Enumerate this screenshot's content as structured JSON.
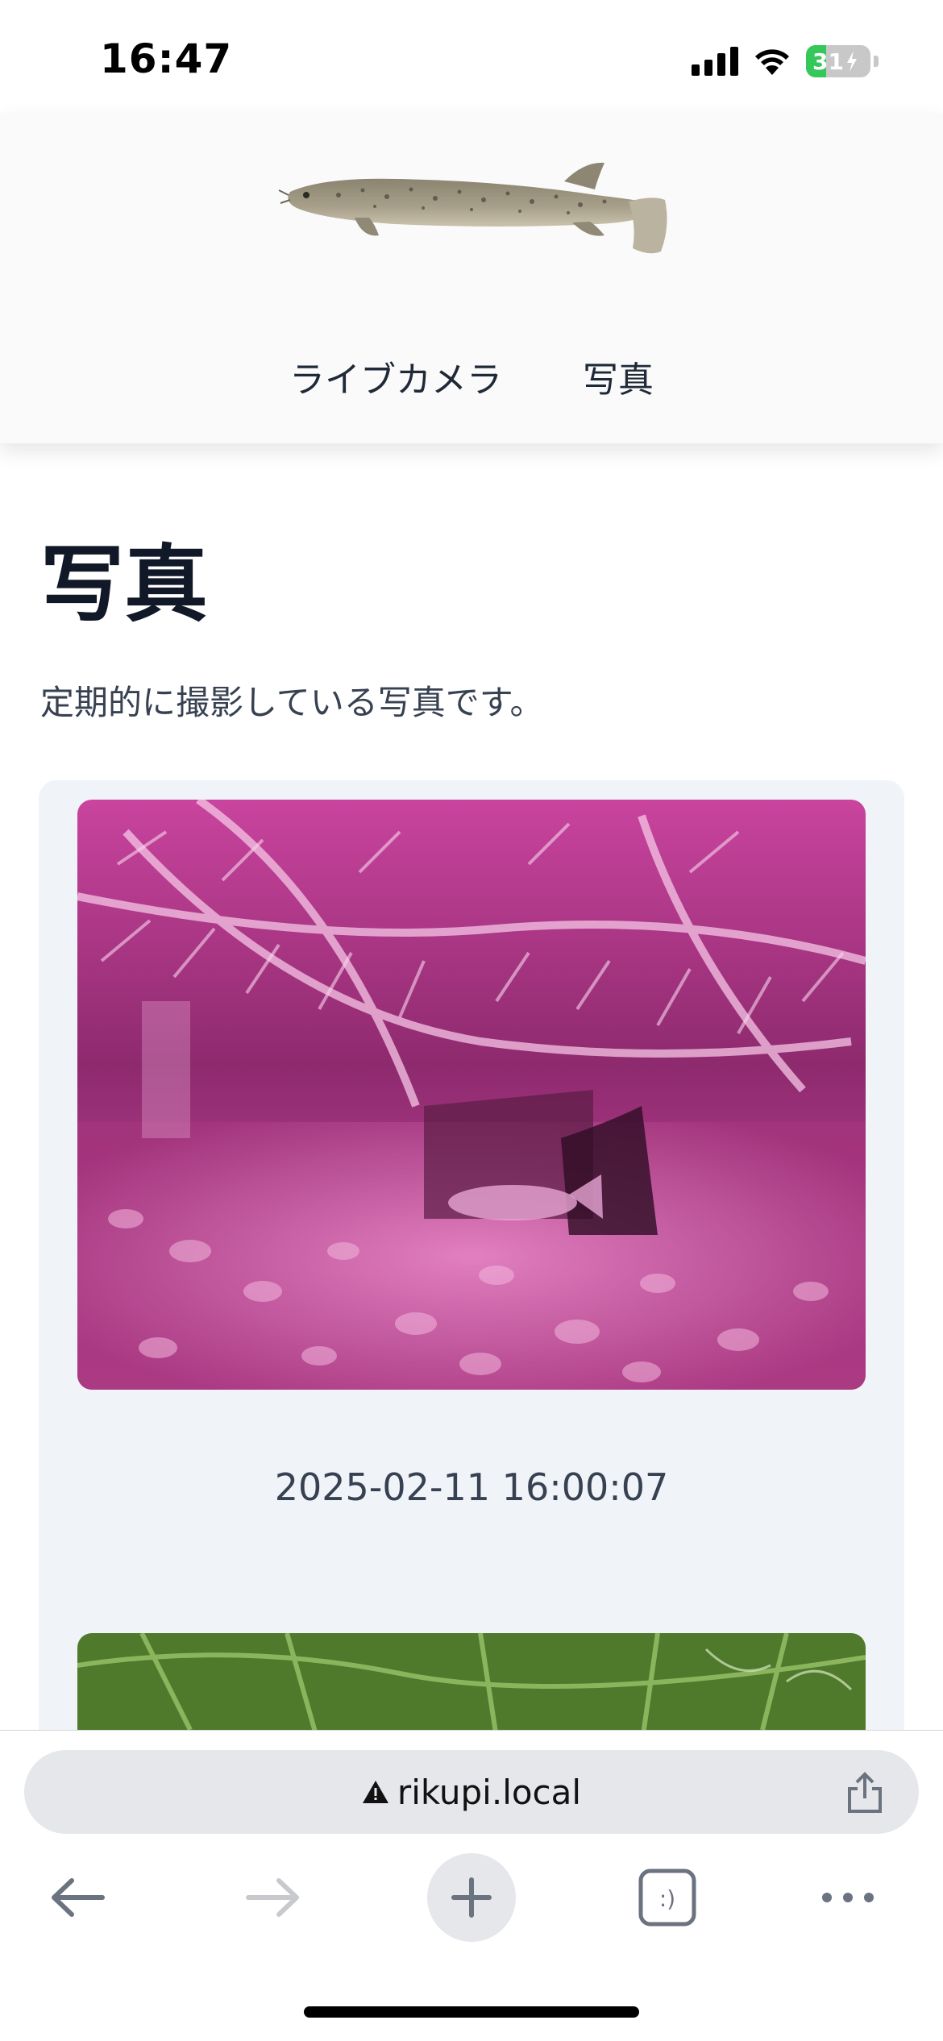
{
  "status": {
    "time": "16:47",
    "battery": "31",
    "battery_level": 0.31,
    "icons": [
      "cellular-signal-icon",
      "wifi-icon",
      "battery-charging-icon"
    ]
  },
  "header": {
    "logo": "loach-fish-logo",
    "nav": [
      {
        "label": "ライブカメラ"
      },
      {
        "label": "写真"
      }
    ]
  },
  "main": {
    "title": "写真",
    "description": "定期的に撮影している写真です。",
    "photos": [
      {
        "caption": "2025-02-11 16:00:07",
        "image": "aquarium-infrared-photo"
      },
      {
        "caption": "",
        "image": "aquarium-daylight-photo"
      }
    ]
  },
  "browser": {
    "url": "rikupi.local",
    "icons": [
      "warning-icon",
      "share-icon",
      "back-arrow-icon",
      "forward-arrow-icon",
      "new-tab-plus-icon",
      "tabs-icon",
      "more-icon"
    ]
  },
  "colors": {
    "header_bg": "#fafafa",
    "gallery_bg": "#f0f4f8",
    "battery_green": "#34c759",
    "text_dark": "#111827"
  }
}
